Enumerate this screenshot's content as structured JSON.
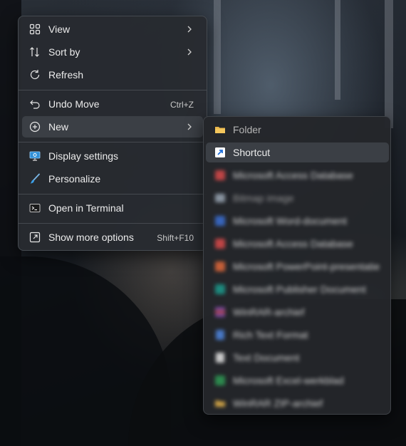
{
  "context_menu": {
    "items": [
      {
        "label": "View",
        "icon": "grid-icon",
        "has_submenu": true
      },
      {
        "label": "Sort by",
        "icon": "sort-icon",
        "has_submenu": true
      },
      {
        "label": "Refresh",
        "icon": "refresh-icon"
      },
      {
        "label": "Undo Move",
        "icon": "undo-icon",
        "shortcut": "Ctrl+Z"
      },
      {
        "label": "New",
        "icon": "plus-circle-icon",
        "has_submenu": true
      },
      {
        "label": "Display settings",
        "icon": "display-settings-icon"
      },
      {
        "label": "Personalize",
        "icon": "brush-icon"
      },
      {
        "label": "Open in Terminal",
        "icon": "terminal-icon"
      },
      {
        "label": "Show more options",
        "icon": "show-more-icon",
        "shortcut": "Shift+F10"
      }
    ]
  },
  "new_submenu": {
    "items": [
      {
        "label": "Folder",
        "icon": "folder-icon"
      },
      {
        "label": "Shortcut",
        "icon": "shortcut-icon"
      },
      {
        "label": "Microsoft Access Database",
        "icon": "access-icon"
      },
      {
        "label": "Bitmap image",
        "icon": "bitmap-icon"
      },
      {
        "label": "Microsoft Word-document",
        "icon": "word-icon"
      },
      {
        "label": "Microsoft Access Database",
        "icon": "access-icon"
      },
      {
        "label": "Microsoft PowerPoint-presentatie",
        "icon": "powerpoint-icon"
      },
      {
        "label": "Microsoft Publisher Document",
        "icon": "publisher-icon"
      },
      {
        "label": "WinRAR-archief",
        "icon": "winrar-icon"
      },
      {
        "label": "Rich Text Format",
        "icon": "rtf-icon"
      },
      {
        "label": "Text Document",
        "icon": "text-document-icon"
      },
      {
        "label": "Microsoft Excel-werkblad",
        "icon": "excel-icon"
      },
      {
        "label": "WinRAR ZIP-archief",
        "icon": "zip-icon"
      }
    ]
  },
  "colors": {
    "menu_bg": "#282b30",
    "highlight": "#3b3f45",
    "accent": "#4cc2ff",
    "text": "#ececec"
  }
}
